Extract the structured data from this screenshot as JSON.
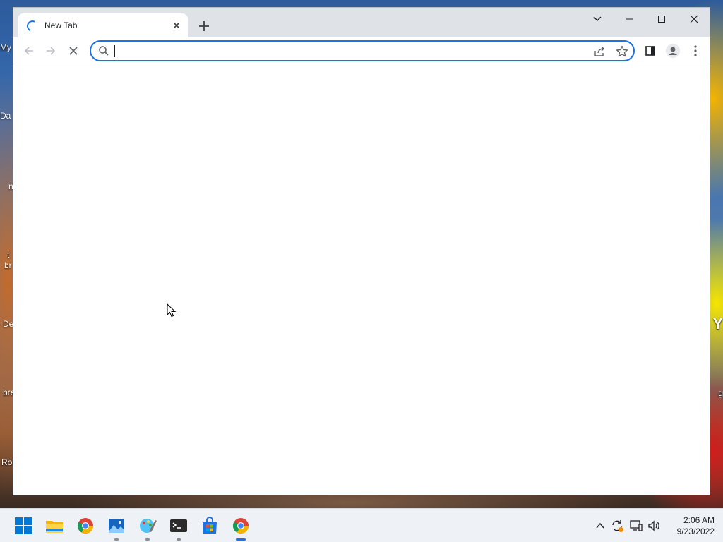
{
  "browser": {
    "tab_title": "New Tab",
    "address_value": "",
    "window_controls": {
      "minimize": "—",
      "maximize": "☐",
      "close": "✕",
      "tab_search": "⌄"
    }
  },
  "desktop": {
    "left_labels": [
      "My",
      "Da",
      "n",
      "t",
      "br",
      "De",
      "bre",
      "Ro"
    ],
    "right_labels": [
      "Y",
      "g"
    ]
  },
  "taskbar": {
    "apps": [
      "start-icon",
      "file-explorer-icon",
      "chrome-icon",
      "photos-icon",
      "paint-icon",
      "terminal-icon",
      "store-icon",
      "chrome-active-icon"
    ],
    "time": "2:06 AM",
    "date": "9/23/2022"
  },
  "colors": {
    "accent": "#1a73e8"
  }
}
